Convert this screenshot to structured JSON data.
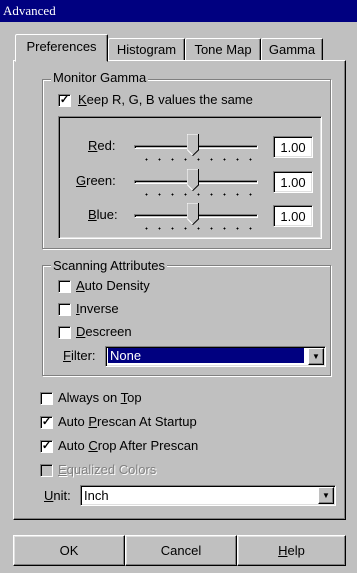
{
  "window": {
    "title": "Advanced"
  },
  "tabs": [
    {
      "label": "Preferences",
      "active": true
    },
    {
      "label": "Histogram",
      "active": false
    },
    {
      "label": "Tone Map",
      "active": false
    },
    {
      "label": "Gamma",
      "active": false
    }
  ],
  "monitor_gamma": {
    "title": "Monitor Gamma",
    "keep_same": {
      "label": "Keep R, G, B values the same",
      "checked": true
    },
    "sliders": [
      {
        "label": "Red:",
        "value": "1.00",
        "level": 0.5
      },
      {
        "label": "Green:",
        "value": "1.00",
        "level": 0.5
      },
      {
        "label": "Blue:",
        "value": "1.00",
        "level": 0.5
      }
    ]
  },
  "scanning": {
    "title": "Scanning Attributes",
    "options": [
      {
        "label": "Auto Density",
        "checked": false
      },
      {
        "label": "Inverse",
        "checked": false
      },
      {
        "label": "Descreen",
        "checked": false
      }
    ],
    "filter": {
      "label": "Filter:",
      "value": "None"
    }
  },
  "options": [
    {
      "label": "Always on Top",
      "checked": false,
      "disabled": false
    },
    {
      "label": "Auto Prescan At Startup",
      "checked": true,
      "disabled": false
    },
    {
      "label": "Auto Crop After Prescan",
      "checked": true,
      "disabled": false
    },
    {
      "label": "Equalized Colors",
      "checked": false,
      "disabled": true
    }
  ],
  "unit": {
    "label": "Unit:",
    "value": "Inch"
  },
  "buttons": {
    "ok": "OK",
    "cancel": "Cancel",
    "help": "Help"
  },
  "colors": {
    "titlebar": "#000080",
    "face": "#c0c0c0",
    "selection": "#000080"
  }
}
